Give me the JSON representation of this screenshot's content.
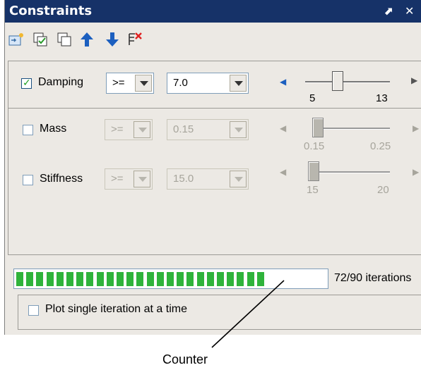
{
  "window": {
    "title": "Constraints",
    "pin_glyph": "⬈",
    "close_glyph": "✕"
  },
  "toolbar": {
    "icons": [
      "add-constraint-icon",
      "copy-checked-icon",
      "copy-icon",
      "move-up-icon",
      "move-down-icon",
      "delete-constraint-icon"
    ]
  },
  "constraints": [
    {
      "enabled": true,
      "label": "Damping",
      "operator": ">=",
      "value": "7.0",
      "slider": {
        "min_label": "5",
        "max_label": "13",
        "level": 0.3
      }
    },
    {
      "enabled": false,
      "label": "Mass",
      "operator": ">=",
      "value": "0.15",
      "slider": {
        "min_label": "0.15",
        "max_label": "0.25",
        "level": 0.0
      }
    },
    {
      "enabled": false,
      "label": "Stiffness",
      "operator": ">=",
      "value": "15.0",
      "slider": {
        "min_label": "15",
        "max_label": "20",
        "level": 0.0
      }
    }
  ],
  "progress": {
    "current": 72,
    "total": 90,
    "text": "72/90 iterations",
    "color": "#2fb33b"
  },
  "plot_option": {
    "checked": false,
    "label": "Plot single iteration at a time"
  },
  "annotation": {
    "label": "Counter"
  },
  "colors": {
    "titlebar": "#163268",
    "panel": "#ece9e4",
    "accent_arrow": "#1c5fbf"
  }
}
